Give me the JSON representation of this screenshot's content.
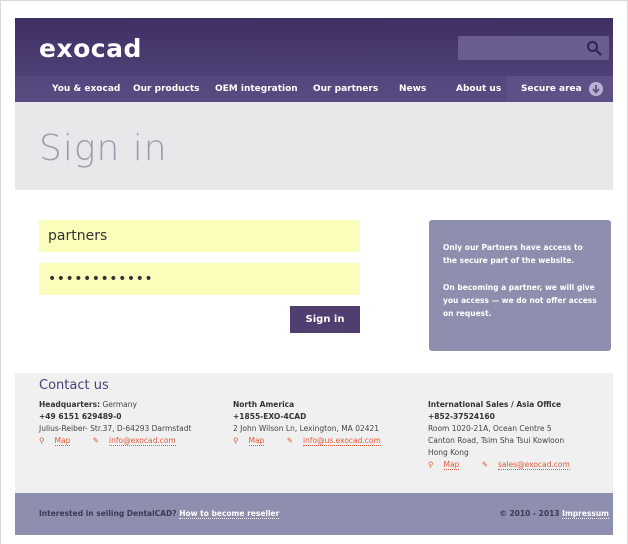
{
  "header": {
    "logo_text": "exocad",
    "search": {
      "placeholder": "",
      "icon": "search-icon"
    },
    "nav": [
      {
        "label": "You & exocad"
      },
      {
        "label": "Our products"
      },
      {
        "label": "OEM integration"
      },
      {
        "label": "Our partners"
      },
      {
        "label": "News"
      },
      {
        "label": "About us"
      },
      {
        "label": "Secure area",
        "icon": "arrow-down-circle-icon"
      }
    ]
  },
  "title": "Sign in",
  "form": {
    "username_value": "partners",
    "password_value": "••••••••••••",
    "signin_label": "Sign in"
  },
  "info_box": {
    "line1": "Only our Partners have access to the secure part of the website.",
    "line2": "On becoming a partner, we will give you access — we do not offer access on request."
  },
  "contact": {
    "title": "Contact us",
    "hq": {
      "label": "Headquarters:",
      "country": " Germany",
      "phone": "+49 6151 629489-0",
      "address": "Julius-Reiber- Str.37, D-64293 Darmstadt",
      "map_label": "Map",
      "email": "info@exocad.com"
    },
    "na": {
      "label": "North America",
      "phone": "+1855-EXO-4CAD",
      "address": "2 John Wilson Ln, Lexington, MA 02421",
      "map_label": "Map",
      "email": "info@us.exocad.com"
    },
    "intl": {
      "label": "International Sales / Asia Office",
      "phone": "+852-37524160",
      "address1": "Room 1020-21A, Ocean Centre 5",
      "address2": "Canton Road, Tsim Sha Tsui Kowloon",
      "address3": "Hong Kong",
      "map_label": "Map",
      "email": "sales@exocad.com"
    }
  },
  "footer": {
    "text": "Interested in selling DentalCAD?",
    "reseller_link": "How to become reseller",
    "copyright": "© 2010 - 2013",
    "impressum": "Impressum"
  },
  "colors": {
    "header_purple": "#4d3d72",
    "accent_orange": "#e05a3a",
    "field_yellow": "#fbfdbb",
    "panel_lavender": "#8e8fae"
  }
}
